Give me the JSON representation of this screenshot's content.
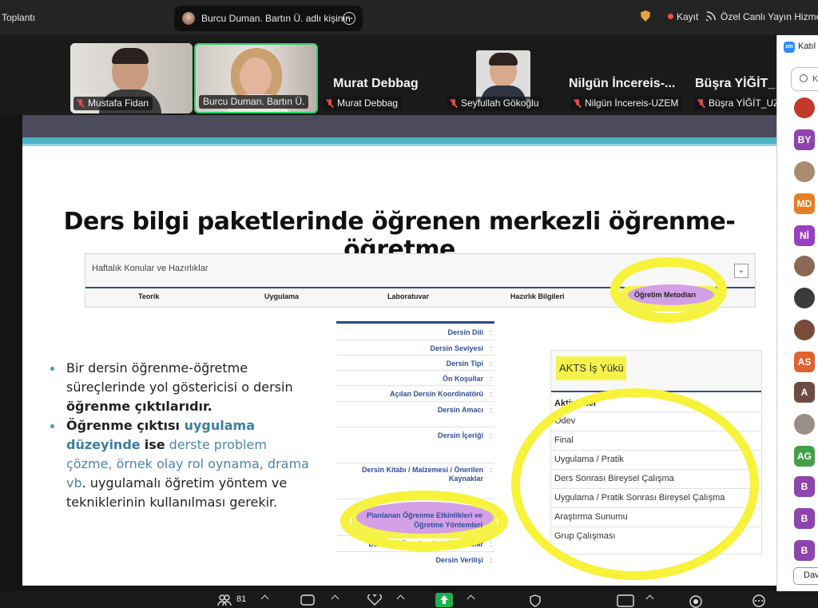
{
  "app": {
    "title": "Toplantı",
    "active_tab": "Burcu Duman. Bartın Ü. adlı kişinin",
    "recording_label": "Kayıt",
    "live_label": "Özel Canlı Yayın Hizmet"
  },
  "participants_strip": [
    {
      "name": "Mustafa Fidan",
      "display": "video"
    },
    {
      "name": "Burcu Duman. Bartın Ü.",
      "display": "video"
    },
    {
      "name": "Murat Debbag",
      "big_name": "Murat Debbag",
      "display": "name"
    },
    {
      "name": "Seyfullah Gökoğlu",
      "display": "photo"
    },
    {
      "name": "Nilgün İncereis-UZEM",
      "big_name": "Nilgün İncereis-...",
      "display": "name"
    },
    {
      "name": "Büşra YİĞİT_UZE",
      "big_name": "Büşra YİĞİT_",
      "display": "name"
    }
  ],
  "slide": {
    "title": "Ders bilgi paketlerinde öğrenen merkezli öğrenme-öğretme",
    "weekly_panel": {
      "title": "Haftalık Konular ve Hazırlıklar",
      "toggle": "⌄",
      "columns": [
        "Teorik",
        "Uygulama",
        "Laboratuvar",
        "Hazırlık Bilgileri",
        "Öğretim Metodları"
      ]
    },
    "bullets": {
      "b1_prefix": "Bir dersin öğrenme-öğretme süreçlerinde yol göstericisi o dersin ",
      "b1_bold": "öğrenme çıktılarıdır.",
      "b2_bold1": "Öğrenme çıktısı ",
      "b2_blue": "uygulama düzeyinde",
      "b2_bold2": "ise",
      "b2_soft": " derste problem çözme, örnek olay rol oynama, drama vb",
      "b2_rest": ". uygulamalı öğretim yöntem ve tekniklerinin kullanılması gerekir."
    },
    "course_fields": [
      "Dersin Dili",
      "Dersin Seviyesi",
      "Dersin Tipi",
      "Ön Koşullar",
      "Açılan Dersin Koordinatörü",
      "Dersin Amacı",
      "Dersin İçeriği",
      "Dersin Kitabı / Malzemesi / Önerilen Kaynaklar",
      "Planlanan Öğrenme Etkinlikleri ve Öğretme Yöntemleri",
      "Ders İçin Önerilen Diğer Hususlar",
      "Dersin Verilişi"
    ],
    "course_colon": ":",
    "akts": {
      "title": "AKTS İş Yükü",
      "column": "Aktiviteler",
      "rows": [
        "Ödev",
        "Final",
        "Uygulama / Pratik",
        "Ders Sonrası Bireysel Çalışma",
        "Uygulama / Pratik Sonrası Bireysel Çalışma",
        "Araştırma Sunumu",
        "Grup Çalışması"
      ]
    }
  },
  "sidebar": {
    "title": "Katıl",
    "search_placeholder": "K",
    "avatars": [
      {
        "label": "",
        "color": "#c0392b"
      },
      {
        "label": "BY",
        "color": "#8e44ad"
      },
      {
        "label": "",
        "color": "#a98b6f"
      },
      {
        "label": "MD",
        "color": "#e67e22"
      },
      {
        "label": "Nİ",
        "color": "#9b3fc1"
      },
      {
        "label": "",
        "color": "#8a6a55"
      },
      {
        "label": "",
        "color": "#3b3b3b"
      },
      {
        "label": "",
        "color": "#7a4a3a"
      },
      {
        "label": "AS",
        "color": "#e0622d"
      },
      {
        "label": "A",
        "color": "#6d4c41"
      },
      {
        "label": "",
        "color": "#9a8f86"
      },
      {
        "label": "AG",
        "color": "#43a047"
      },
      {
        "label": "B",
        "color": "#8e44ad"
      },
      {
        "label": "B",
        "color": "#8e44ad"
      },
      {
        "label": "B",
        "color": "#8e44ad"
      }
    ],
    "button": "Dav"
  },
  "toolbar": {
    "participants_count": "81"
  }
}
